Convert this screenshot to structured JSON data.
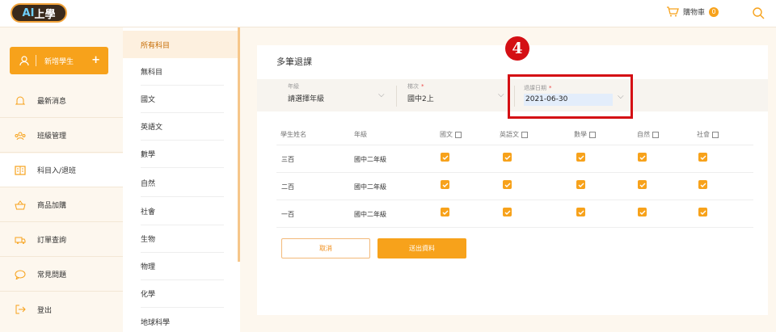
{
  "header": {
    "logo_ai": "AI",
    "logo_text": "上學",
    "cart_label": "購物車",
    "cart_count": "0"
  },
  "leftnav": {
    "add_student": "新增學生",
    "items": [
      {
        "label": "最新消息",
        "icon": "bell-icon"
      },
      {
        "label": "班級管理",
        "icon": "class-icon"
      },
      {
        "label": "科目入/退班",
        "icon": "book-icon",
        "active": true
      },
      {
        "label": "商品加購",
        "icon": "basket-icon"
      },
      {
        "label": "訂單查詢",
        "icon": "truck-icon"
      },
      {
        "label": "常見問題",
        "icon": "chat-icon"
      },
      {
        "label": "登出",
        "icon": "logout-icon"
      }
    ]
  },
  "subjects": [
    "所有科目",
    "無科目",
    "國文",
    "英語文",
    "數學",
    "自然",
    "社會",
    "生物",
    "物理",
    "化學",
    "地球科學"
  ],
  "main": {
    "title": "多筆退課",
    "filters": {
      "grade_label": "年級",
      "grade_value": "請選擇年級",
      "session_label": "梯次",
      "session_value": "國中2上",
      "date_label": "退課日期",
      "date_value": "2021-06-30"
    },
    "step": "4",
    "table": {
      "headers": [
        "學生姓名",
        "年級",
        "國文",
        "英語文",
        "數學",
        "自然",
        "社會"
      ],
      "rows": [
        {
          "name": "三百",
          "grade": "國中二年級"
        },
        {
          "name": "二百",
          "grade": "國中二年級"
        },
        {
          "name": "一百",
          "grade": "國中二年級"
        }
      ]
    },
    "cancel_label": "取消",
    "submit_label": "送出資料"
  },
  "colors": {
    "accent": "#f7a21b",
    "highlight": "#d40f14"
  }
}
